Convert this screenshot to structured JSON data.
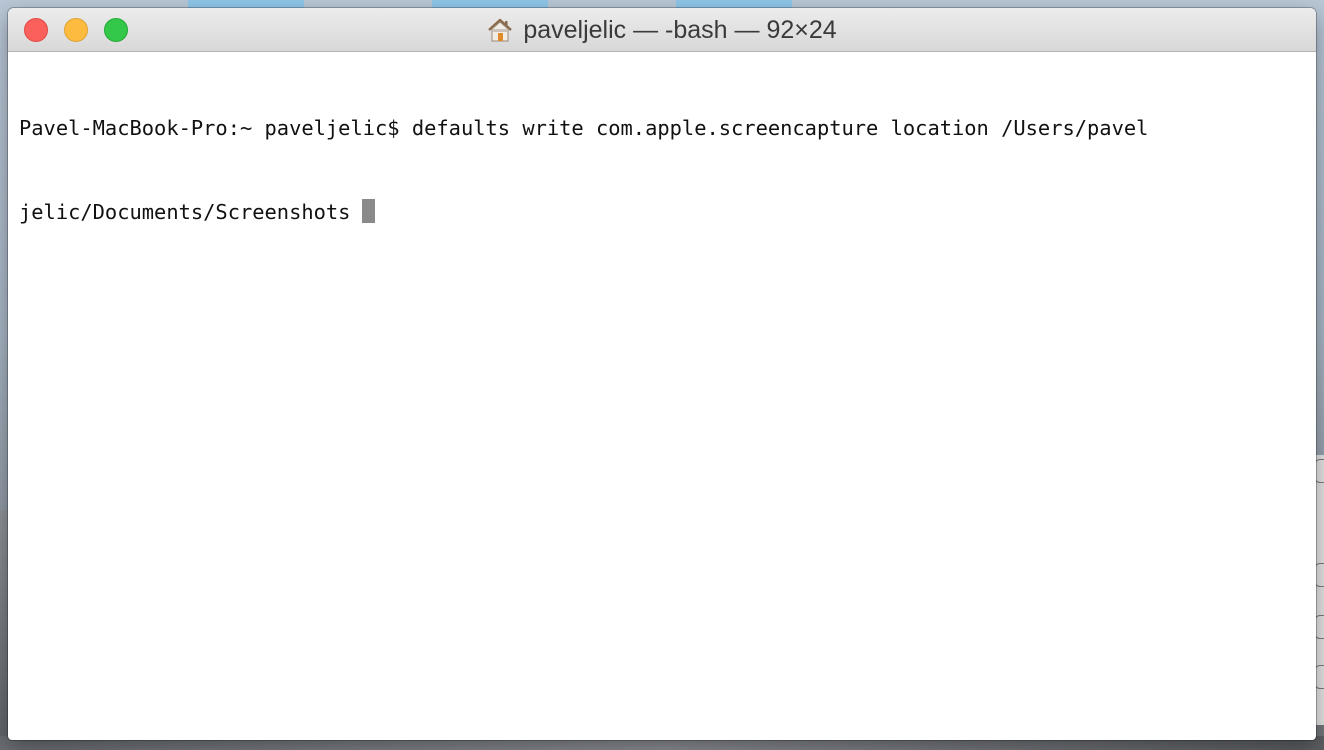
{
  "window": {
    "title": "paveljelic — -bash — 92×24",
    "icon": "home-icon",
    "buttons": {
      "close": "close-button",
      "minimize": "minimize-button",
      "zoom": "zoom-button"
    }
  },
  "terminal": {
    "lines": [
      "Pavel-MacBook-Pro:~ paveljelic$ defaults write com.apple.screencapture location /Users/pavel",
      "jelic/Documents/Screenshots"
    ],
    "cursor_color": "#8a8a8a"
  },
  "colors": {
    "close": "#fc605c",
    "minimize": "#fdbc40",
    "zoom": "#34c84a"
  }
}
